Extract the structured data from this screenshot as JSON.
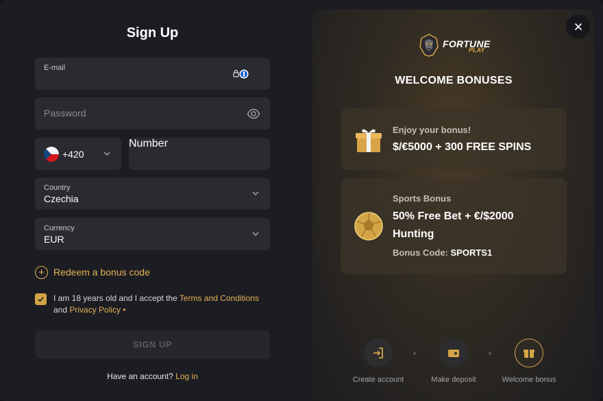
{
  "signup": {
    "title": "Sign Up",
    "email_label": "E-mail",
    "email_value": "",
    "password_placeholder": "Password",
    "phone_code": "+420",
    "phone_placeholder": "Number",
    "country_label": "Country",
    "country_value": "Czechia",
    "currency_label": "Currency",
    "currency_value": "EUR",
    "redeem_label": "Redeem a bonus code",
    "terms_prefix": "I am 18 years old and I accept the ",
    "terms_link": "Terms and Conditions",
    "terms_and": " and ",
    "privacy_link": "Privacy Policy",
    "privacy_suffix": " •",
    "terms_checked": true,
    "submit_label": "SIGN UP",
    "have_account": "Have an account? ",
    "login_link": "Log in"
  },
  "promo": {
    "logo_primary": "FORTUNE",
    "logo_secondary": "PLAY",
    "title": "WELCOME BONUSES",
    "cards": [
      {
        "sub": "Enjoy your bonus!",
        "main": "$/€5000 + 300 FREE SPINS",
        "icon": "gift-icon"
      },
      {
        "sub": "Sports Bonus",
        "main_line1": "50% Free Bet + €/$2000",
        "main_line2": "Hunting",
        "code_label": "Bonus Code: ",
        "code_value": "SPORTS1",
        "icon": "football-icon"
      }
    ],
    "steps": [
      {
        "label": "Create account",
        "icon": "login-arrow-icon",
        "active": false
      },
      {
        "label": "Make deposit",
        "icon": "wallet-icon",
        "active": false
      },
      {
        "label": "Welcome bonus",
        "icon": "gift-icon",
        "active": true
      }
    ]
  },
  "colors": {
    "accent": "#d4a547",
    "link": "#e3b255",
    "field_bg": "#2a2b31",
    "modal_bg": "#1c1d22"
  }
}
